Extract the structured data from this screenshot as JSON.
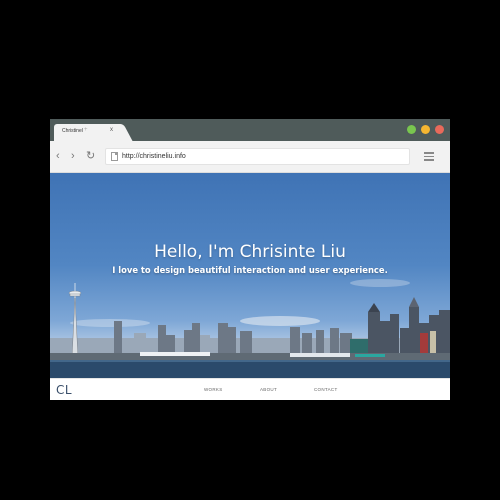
{
  "browser": {
    "tab": {
      "title": "Christinel",
      "new_tab": "+",
      "close": "x"
    },
    "window_controls": {
      "green": "#79c64f",
      "yellow": "#f5b631",
      "red": "#e96a5b"
    },
    "toolbar": {
      "back": "‹",
      "forward": "›",
      "reload": "↻"
    },
    "address": {
      "url": "http://christineliu.info"
    },
    "menu_icon": "hamburger-menu-icon"
  },
  "hero": {
    "title": "Hello, I'm Chrisinte Liu",
    "subtitle": "I love to design beautiful interaction and user experience.",
    "background": "seattle-skyline-photo"
  },
  "site_nav": {
    "logo": "CL",
    "links": [
      "WORKS",
      "ABOUT",
      "CONTACT"
    ]
  }
}
